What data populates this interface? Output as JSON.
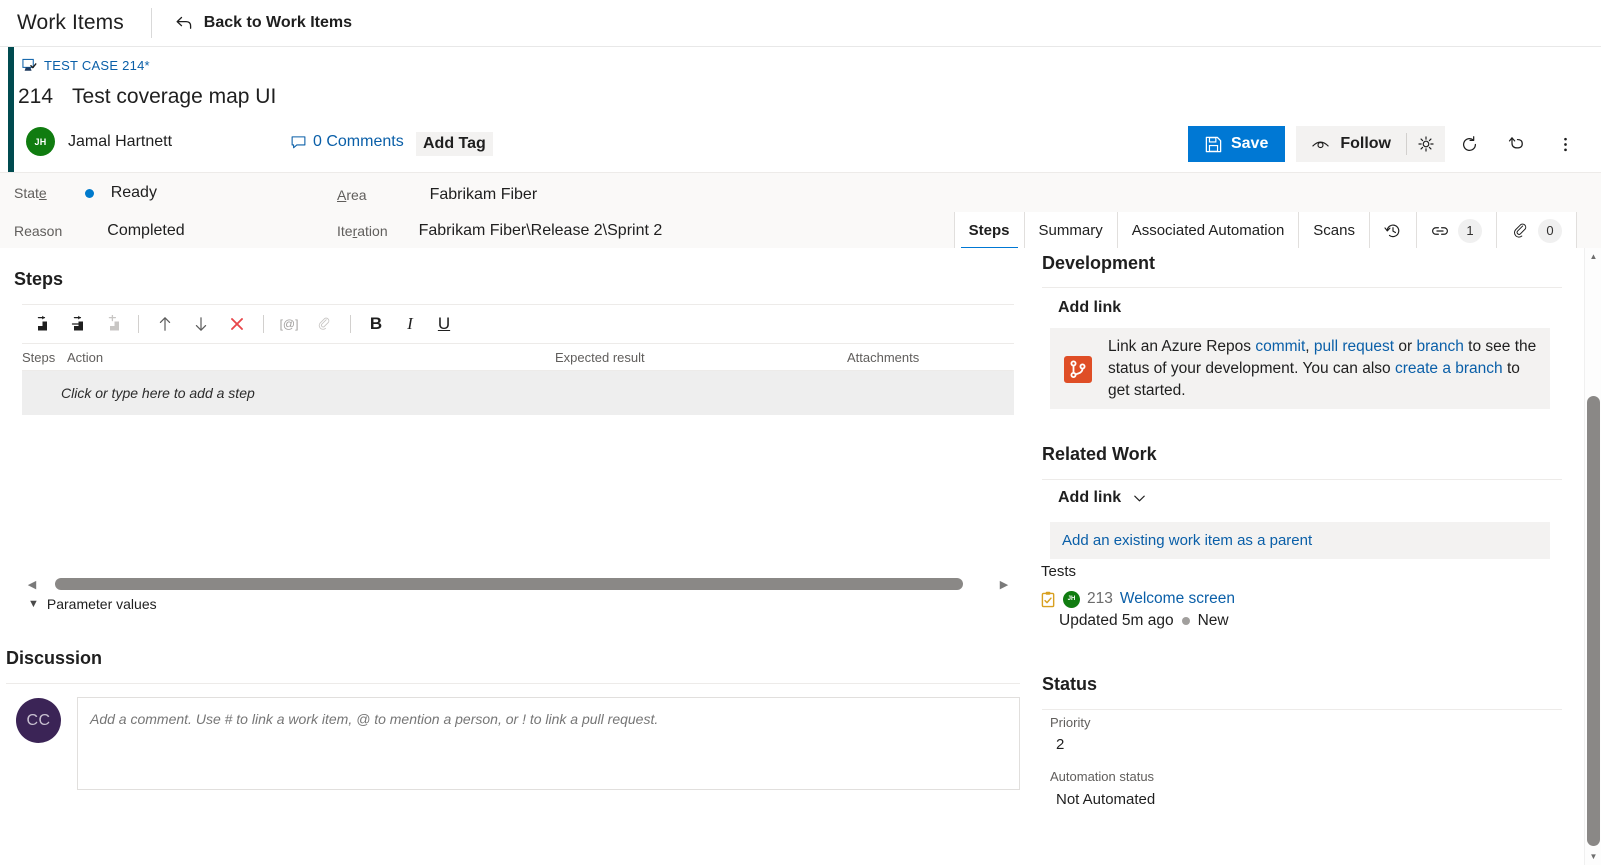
{
  "hub": {
    "title": "Work Items",
    "back_label": "Back to Work Items",
    "back_icon": "back-arrow-icon"
  },
  "work_item": {
    "type_label": "TEST CASE 214*",
    "type_icon": "test-case-icon",
    "id": "214",
    "title": "Test coverage map UI",
    "assigned_to": "Jamal Hartnett",
    "assigned_to_initials": "JH",
    "comments_label": "0 Comments",
    "comments_icon": "comment-bubble-icon",
    "add_tag_label": "Add Tag",
    "accent_color": "#004b50"
  },
  "toolbar": {
    "save_label": "Save",
    "save_icon": "save-disk-icon",
    "save_color": "#0078d4",
    "follow_label": "Follow",
    "follow_icon": "eye-icon",
    "settings_icon": "gear-icon",
    "refresh_icon": "refresh-icon",
    "revert_icon": "undo-icon",
    "more_icon": "more-vertical-icon"
  },
  "fields": [
    {
      "label_pre": "Stat",
      "label_accel": "e",
      "label_post": "",
      "value": "Ready",
      "has_dot": true,
      "dot_color": "#007acc"
    },
    {
      "label_pre": "Reason",
      "label_accel": "",
      "label_post": "",
      "value": "Completed",
      "has_dot": false
    },
    {
      "label_pre": "",
      "label_accel": "A",
      "label_post": "rea",
      "value": "Fabrikam Fiber",
      "has_dot": false
    },
    {
      "label_pre": "Ite",
      "label_accel": "r",
      "label_post": "ation",
      "value": "Fabrikam Fiber\\Release 2\\Sprint 2",
      "has_dot": false
    }
  ],
  "tabs": [
    {
      "label": "Steps",
      "active": true,
      "type": "text"
    },
    {
      "label": "Summary",
      "active": false,
      "type": "text"
    },
    {
      "label": "Associated Automation",
      "active": false,
      "type": "text"
    },
    {
      "label": "Scans",
      "active": false,
      "type": "text"
    },
    {
      "label": "",
      "active": false,
      "type": "icon",
      "icon": "history-icon"
    },
    {
      "label": "",
      "active": false,
      "type": "icon",
      "icon": "link-icon",
      "badge": "1"
    },
    {
      "label": "",
      "active": false,
      "type": "icon",
      "icon": "attachment-icon",
      "badge": "0"
    }
  ],
  "steps_panel": {
    "heading": "Steps",
    "toolbar_items": [
      {
        "name": "insert-step-icon",
        "disabled": false
      },
      {
        "name": "insert-shared-step-icon",
        "disabled": false
      },
      {
        "name": "insert-step-after-icon",
        "disabled": true
      },
      {
        "name": "separator",
        "disabled": false
      },
      {
        "name": "move-up-icon",
        "disabled": false
      },
      {
        "name": "move-down-icon",
        "disabled": false
      },
      {
        "name": "delete-icon",
        "disabled": false
      },
      {
        "name": "separator",
        "disabled": false
      },
      {
        "name": "insert-parameter-icon",
        "label": "[@]",
        "disabled": true
      },
      {
        "name": "attach-file-icon",
        "disabled": true
      },
      {
        "name": "separator",
        "disabled": false
      },
      {
        "name": "bold-icon",
        "label": "B",
        "disabled": false
      },
      {
        "name": "italic-icon",
        "label": "I",
        "disabled": false
      },
      {
        "name": "underline-icon",
        "label": "U",
        "disabled": false
      }
    ],
    "columns": [
      "Steps",
      "Action",
      "Expected result",
      "Attachments"
    ],
    "empty_row_text": "Click or type here to add a step",
    "parameter_values_label": "Parameter values"
  },
  "discussion": {
    "heading": "Discussion",
    "avatar_initials": "CC",
    "placeholder": "Add a comment. Use # to link a work item, @ to mention a person, or ! to link a pull request."
  },
  "development": {
    "heading": "Development",
    "add_link_label": "Add link",
    "icon": "azure-repos-icon",
    "text_parts": [
      {
        "t": "Link an Azure Repos ",
        "link": false
      },
      {
        "t": "commit",
        "link": true
      },
      {
        "t": ", ",
        "link": false
      },
      {
        "t": "pull request",
        "link": true
      },
      {
        "t": " or ",
        "link": false
      },
      {
        "t": "branch",
        "link": true
      },
      {
        "t": " to see the status of your development. You can also ",
        "link": false
      },
      {
        "t": "create a branch",
        "link": true
      },
      {
        "t": " to get started.",
        "link": false
      }
    ]
  },
  "related_work": {
    "heading": "Related Work",
    "add_link_label": "Add link",
    "add_link_chevron": "chevron-down-icon",
    "add_parent_label": "Add an existing work item as a parent",
    "group_label": "Tests",
    "items": [
      {
        "icon": "test-case-clipboard-icon",
        "avatar_initials": "JH",
        "id": "213",
        "title": "Welcome screen",
        "updated": "Updated 5m ago",
        "state": "New"
      }
    ]
  },
  "status": {
    "heading": "Status",
    "rows": [
      {
        "label": "Priority",
        "value": "2"
      },
      {
        "label": "Automation status",
        "value": "Not Automated"
      }
    ]
  }
}
